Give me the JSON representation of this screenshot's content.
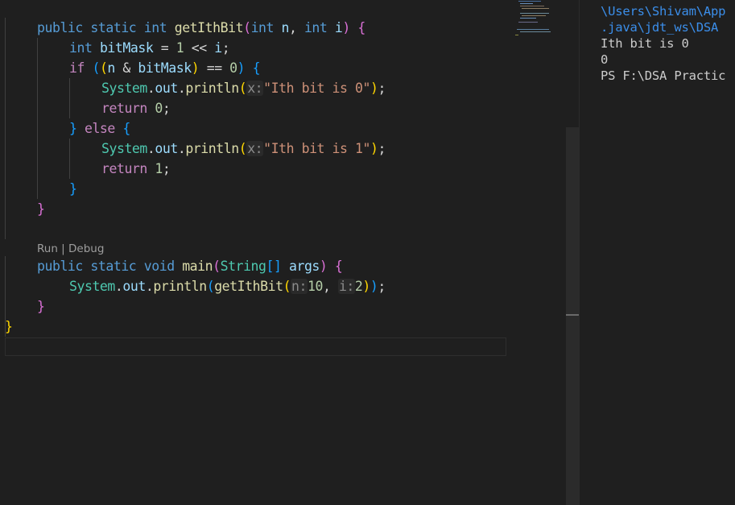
{
  "editor": {
    "lines": [
      {
        "tokens": [
          [
            "public",
            "kw"
          ],
          [
            " ",
            "op"
          ],
          [
            "static",
            "kw"
          ],
          [
            " ",
            "op"
          ],
          [
            "int",
            "kw"
          ],
          [
            " ",
            "op"
          ],
          [
            "getIthBit",
            "fn"
          ],
          [
            "(",
            "b2"
          ],
          [
            "int",
            "kw"
          ],
          [
            " ",
            "op"
          ],
          [
            "n",
            "var"
          ],
          [
            ", ",
            "op"
          ],
          [
            "int",
            "kw"
          ],
          [
            " ",
            "op"
          ],
          [
            "i",
            "var"
          ],
          [
            ")",
            "b2"
          ],
          [
            " ",
            "op"
          ],
          [
            "{",
            "b2"
          ]
        ]
      },
      {
        "tokens": [
          [
            "int",
            "kw"
          ],
          [
            " ",
            "op"
          ],
          [
            "bitMask",
            "var"
          ],
          [
            " = ",
            "op"
          ],
          [
            "1",
            "num"
          ],
          [
            " << ",
            "op"
          ],
          [
            "i",
            "var"
          ],
          [
            ";",
            "op"
          ]
        ]
      },
      {
        "tokens": [
          [
            "if",
            "ctl"
          ],
          [
            " ",
            "op"
          ],
          [
            "(",
            "b3"
          ],
          [
            "(",
            "b1"
          ],
          [
            "n",
            "var"
          ],
          [
            " & ",
            "op"
          ],
          [
            "bitMask",
            "var"
          ],
          [
            ")",
            "b1"
          ],
          [
            " == ",
            "op"
          ],
          [
            "0",
            "num"
          ],
          [
            ")",
            "b3"
          ],
          [
            " ",
            "op"
          ],
          [
            "{",
            "b3"
          ]
        ]
      },
      {
        "tokens": [
          [
            "System",
            "typ"
          ],
          [
            ".",
            "op"
          ],
          [
            "out",
            "var"
          ],
          [
            ".",
            "op"
          ],
          [
            "println",
            "fn"
          ],
          [
            "(",
            "b1"
          ],
          [
            "x:",
            "hint"
          ],
          [
            "\"Ith bit is 0\"",
            "str"
          ],
          [
            ")",
            "b1"
          ],
          [
            ";",
            "op"
          ]
        ]
      },
      {
        "tokens": [
          [
            "return",
            "ctl"
          ],
          [
            " ",
            "op"
          ],
          [
            "0",
            "num"
          ],
          [
            ";",
            "op"
          ]
        ]
      },
      {
        "tokens": [
          [
            "}",
            "b3"
          ],
          [
            " ",
            "op"
          ],
          [
            "else",
            "ctl"
          ],
          [
            " ",
            "op"
          ],
          [
            "{",
            "b3"
          ]
        ]
      },
      {
        "tokens": [
          [
            "System",
            "typ"
          ],
          [
            ".",
            "op"
          ],
          [
            "out",
            "var"
          ],
          [
            ".",
            "op"
          ],
          [
            "println",
            "fn"
          ],
          [
            "(",
            "b1"
          ],
          [
            "x:",
            "hint"
          ],
          [
            "\"Ith bit is 1\"",
            "str"
          ],
          [
            ")",
            "b1"
          ],
          [
            ";",
            "op"
          ]
        ]
      },
      {
        "tokens": [
          [
            "return",
            "ctl"
          ],
          [
            " ",
            "op"
          ],
          [
            "1",
            "num"
          ],
          [
            ";",
            "op"
          ]
        ]
      },
      {
        "tokens": [
          [
            "}",
            "b3"
          ]
        ]
      },
      {
        "tokens": [
          [
            "}",
            "b2"
          ]
        ]
      },
      {
        "tokens": []
      },
      {
        "tokens": [
          [
            "public",
            "kw"
          ],
          [
            " ",
            "op"
          ],
          [
            "static",
            "kw"
          ],
          [
            " ",
            "op"
          ],
          [
            "void",
            "kw"
          ],
          [
            " ",
            "op"
          ],
          [
            "main",
            "fn"
          ],
          [
            "(",
            "b2"
          ],
          [
            "String",
            "typ"
          ],
          [
            "[]",
            "b3"
          ],
          [
            " ",
            "op"
          ],
          [
            "args",
            "var"
          ],
          [
            ")",
            "b2"
          ],
          [
            " ",
            "op"
          ],
          [
            "{",
            "b2"
          ]
        ]
      },
      {
        "tokens": [
          [
            "System",
            "typ"
          ],
          [
            ".",
            "op"
          ],
          [
            "out",
            "var"
          ],
          [
            ".",
            "op"
          ],
          [
            "println",
            "fn"
          ],
          [
            "(",
            "b3"
          ],
          [
            "getIthBit",
            "fn"
          ],
          [
            "(",
            "b1"
          ],
          [
            "n:",
            "hint"
          ],
          [
            "10",
            "num"
          ],
          [
            ", ",
            "op"
          ],
          [
            "i:",
            "hint"
          ],
          [
            "2",
            "num"
          ],
          [
            ")",
            "b1"
          ],
          [
            ")",
            "b3"
          ],
          [
            ";",
            "op"
          ]
        ]
      },
      {
        "tokens": [
          [
            "}",
            "b2"
          ]
        ]
      },
      {
        "tokens": [
          [
            "}",
            "b1"
          ]
        ]
      }
    ],
    "codelens": {
      "run": "Run",
      "sep": " | ",
      "debug": "Debug"
    }
  },
  "terminal": {
    "lines": [
      {
        "text": "\\Users\\Shivam\\App",
        "color": "tblue"
      },
      {
        "text": ".java\\jdt_ws\\DSA",
        "color": "tblue"
      },
      {
        "text": "Ith bit is 0",
        "color": "twhite"
      },
      {
        "text": "0",
        "color": "twhite"
      },
      {
        "text": "PS F:\\DSA Practic",
        "color": "twhite"
      }
    ]
  }
}
